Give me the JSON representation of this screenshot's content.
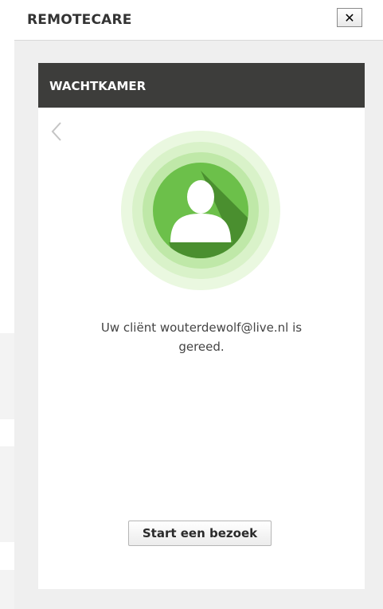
{
  "window": {
    "title": "REMOTECARE",
    "close_label": "✕"
  },
  "panel": {
    "title": "WACHTKAMER",
    "back_icon": "chevron-left-icon",
    "avatar_icon": "user-icon",
    "status_line1": "Uw cliënt wouterdewolf@live.nl is",
    "status_line2": "gereed.",
    "start_button_label": "Start een bezoek"
  },
  "colors": {
    "header_bg": "#3d3d3b",
    "avatar_green": "#6cc04a",
    "avatar_ring_1": "#bfe8a8",
    "avatar_ring_2": "#d9f2c9",
    "avatar_ring_3": "#eaf8e0"
  }
}
